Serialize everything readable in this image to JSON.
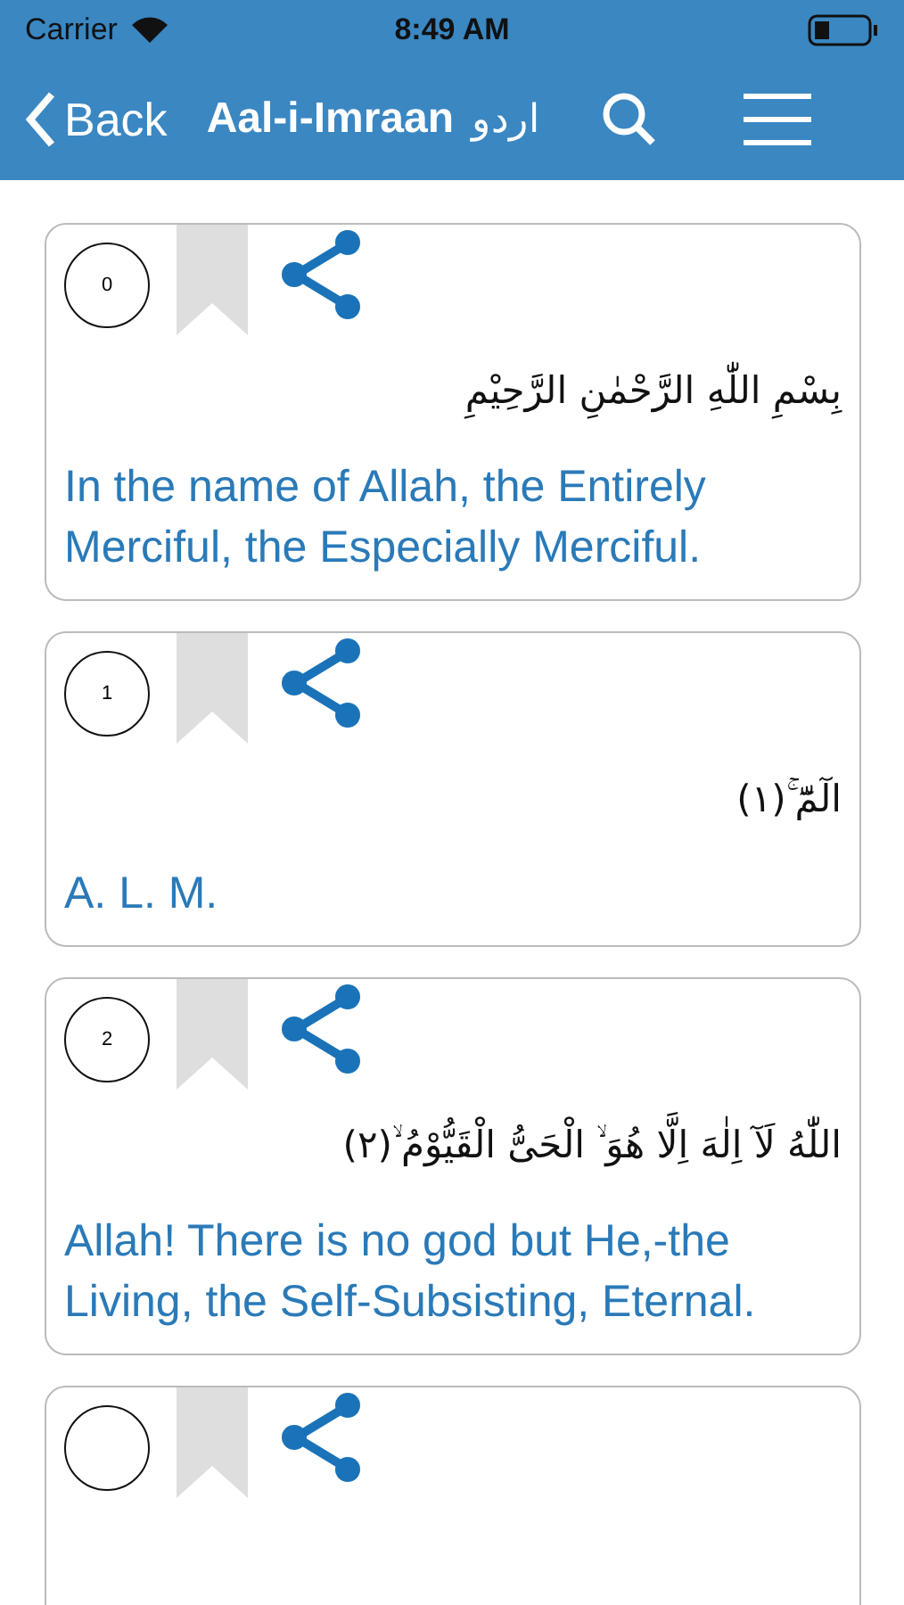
{
  "status_bar": {
    "carrier": "Carrier",
    "time": "8:49 AM"
  },
  "nav": {
    "back": "Back",
    "title": "Aal-i-Imraan",
    "language": "اردو"
  },
  "verses": [
    {
      "number": "0",
      "bookmarked": false,
      "arabic": "بِسْمِ اللّٰهِ الرَّحْمٰنِ الرَّحِيْمِ",
      "translation": "In the name of Allah, the Entirely Merciful, the Especially Merciful."
    },
    {
      "number": "1",
      "bookmarked": false,
      "arabic": "الٓمّٓ ۚ(١)",
      "translation": "A. L. M."
    },
    {
      "number": "2",
      "bookmarked": false,
      "arabic": "اللّٰهُ لَآ اِلٰهَ اِلَّا هُوَ ۙ الْحَیُّ الْقَیُّوْمُ ۙ(٢)",
      "translation": "Allah! There is no god but He,-the Living, the Self-Subsisting, Eternal."
    },
    {
      "bookmarked": false
    }
  ]
}
